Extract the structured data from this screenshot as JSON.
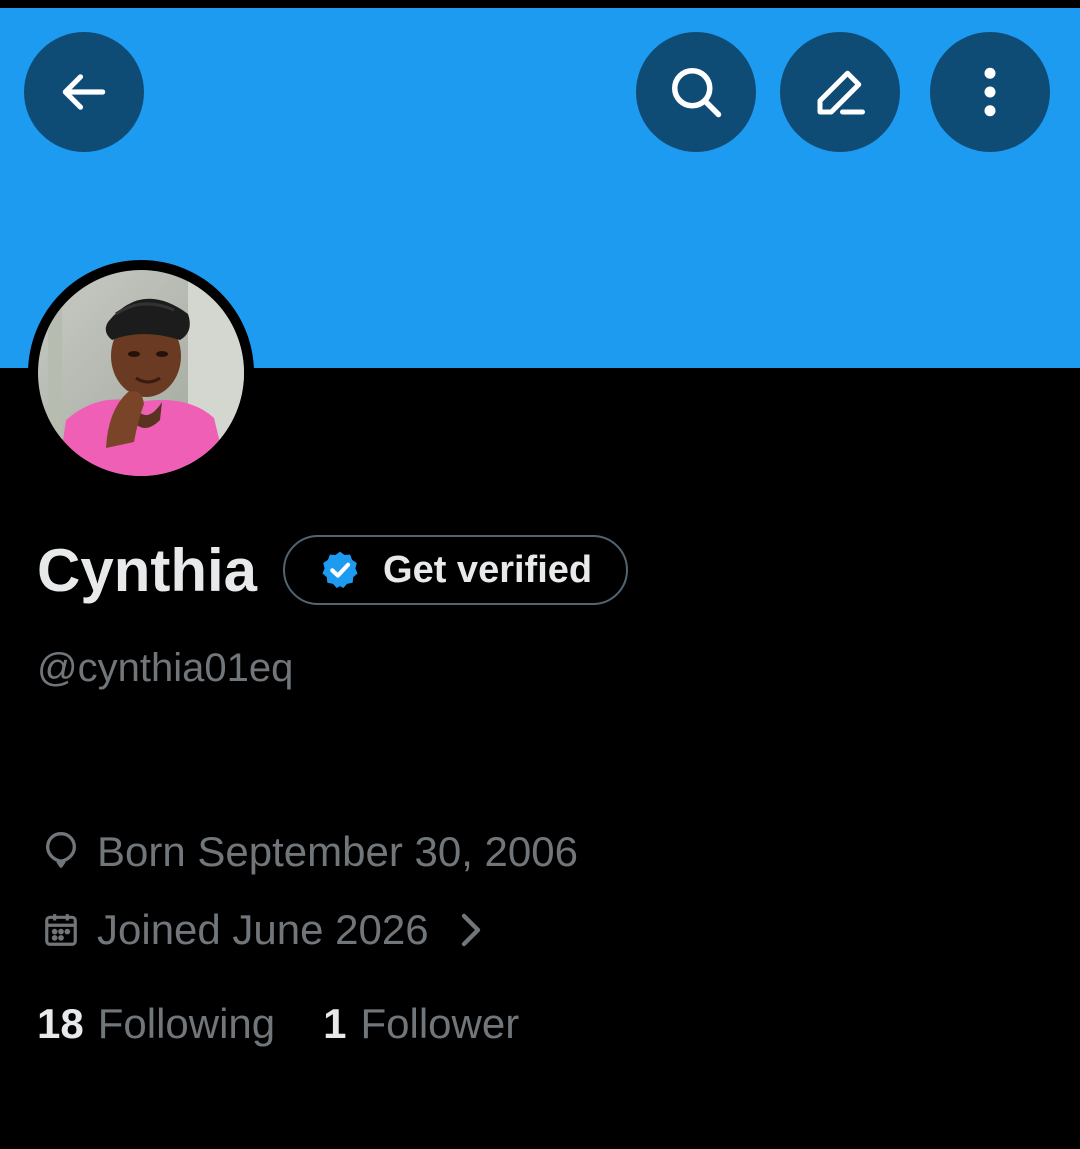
{
  "header": {
    "back_icon": "arrow-left-icon",
    "search_icon": "search-icon",
    "edit_icon": "pencil-icon",
    "more_icon": "more-vertical-icon"
  },
  "colors": {
    "banner": "#1d9bf0",
    "button_bg": "#0f4c75",
    "background": "#000000",
    "primary_text": "#e7e9ea",
    "secondary_text": "#71767b",
    "verified_badge": "#1d9bf0"
  },
  "profile": {
    "display_name": "Cynthia",
    "verify_label": "Get verified",
    "verify_icon": "verified-badge-icon",
    "handle": "@cynthia01eq",
    "born": "Born September 30, 2006",
    "born_icon": "balloon-icon",
    "joined": "Joined June 2026",
    "joined_icon": "calendar-icon",
    "joined_chevron": "chevron-right-icon",
    "following_count": "18",
    "following_label": "Following",
    "follower_count": "1",
    "follower_label": "Follower"
  }
}
